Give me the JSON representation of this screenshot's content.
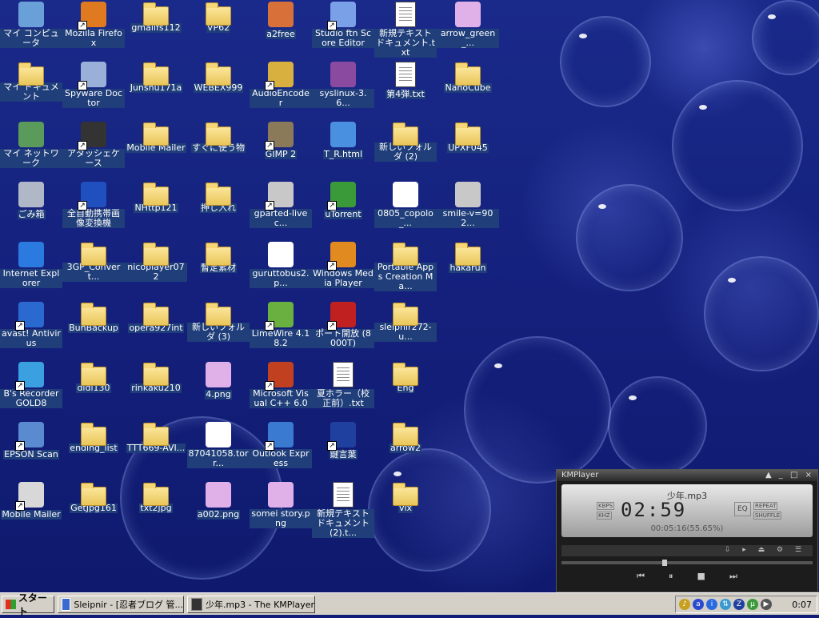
{
  "desktop": {
    "icons": [
      {
        "label": "マイ コンピュータ",
        "kind": "app",
        "icon": "my-computer-icon",
        "color": "#6aa0d8"
      },
      {
        "label": "Mozilla Firefox",
        "kind": "app shortcut",
        "icon": "firefox-icon",
        "color": "#e07a20"
      },
      {
        "label": "gmailfs112",
        "kind": "folder",
        "icon": "folder-icon"
      },
      {
        "label": "VP62",
        "kind": "folder",
        "icon": "folder-icon"
      },
      {
        "label": "a2free",
        "kind": "app",
        "icon": "a2free-icon",
        "color": "#d8703a"
      },
      {
        "label": "Studio ftn Score Editor",
        "kind": "app shortcut",
        "icon": "music-notes-icon",
        "color": "#7aa0e8"
      },
      {
        "label": "新規テキスト ドキュメント.txt",
        "kind": "doc",
        "icon": "text-file-icon"
      },
      {
        "label": "arrow_green_...",
        "kind": "app",
        "icon": "image-file-icon",
        "color": "#e0b0e8"
      },
      {
        "label": "マイ ドキュメント",
        "kind": "folder",
        "icon": "my-documents-icon"
      },
      {
        "label": "Spyware Doctor",
        "kind": "app shortcut",
        "icon": "spyware-doctor-icon",
        "color": "#9ab0d8"
      },
      {
        "label": "Junshu171a",
        "kind": "folder",
        "icon": "folder-icon"
      },
      {
        "label": "WEBEX999",
        "kind": "folder",
        "icon": "folder-icon"
      },
      {
        "label": "AudioEncoder",
        "kind": "app shortcut",
        "icon": "audio-encoder-icon",
        "color": "#d8b040"
      },
      {
        "label": "syslinux-3.6...",
        "kind": "app",
        "icon": "archive-icon",
        "color": "#8a4aa0"
      },
      {
        "label": "第4弾.txt",
        "kind": "doc",
        "icon": "text-file-icon"
      },
      {
        "label": "NanoCube",
        "kind": "folder",
        "icon": "folder-icon"
      },
      {
        "label": "マイ ネットワーク",
        "kind": "app",
        "icon": "my-network-icon",
        "color": "#5a9a5a"
      },
      {
        "label": "アタッシェケース",
        "kind": "app shortcut",
        "icon": "briefcase-icon",
        "color": "#333333"
      },
      {
        "label": "Mobile Mailer",
        "kind": "folder",
        "icon": "folder-icon"
      },
      {
        "label": "すぐに使う物",
        "kind": "folder",
        "icon": "folder-icon"
      },
      {
        "label": "GIMP 2",
        "kind": "app shortcut",
        "icon": "gimp-icon",
        "color": "#8a7a5a"
      },
      {
        "label": "T_R.html",
        "kind": "app",
        "icon": "html-file-icon",
        "color": "#4a90e0"
      },
      {
        "label": "新しいフォルダ (2)",
        "kind": "folder",
        "icon": "folder-icon"
      },
      {
        "label": "UPXF045",
        "kind": "folder",
        "icon": "folder-icon"
      },
      {
        "label": "ごみ箱",
        "kind": "app",
        "icon": "recycle-bin-icon",
        "color": "#b0b8c8"
      },
      {
        "label": "全自動携帯画像変換機",
        "kind": "app shortcut",
        "icon": "phone-converter-icon",
        "color": "#2050c0"
      },
      {
        "label": "NHttp121",
        "kind": "folder",
        "icon": "folder-icon"
      },
      {
        "label": "押し入れ",
        "kind": "folder",
        "icon": "folder-icon"
      },
      {
        "label": "gparted-livec...",
        "kind": "app shortcut",
        "icon": "disc-image-icon",
        "color": "#c8c8c8"
      },
      {
        "label": "uTorrent",
        "kind": "app shortcut",
        "icon": "utorrent-icon",
        "color": "#3a9a3a"
      },
      {
        "label": "0805_copolo_...",
        "kind": "app",
        "icon": "media-file-icon",
        "color": "#ffffff"
      },
      {
        "label": "smile-v=902...",
        "kind": "app",
        "icon": "disc-image-icon",
        "color": "#c8c8c8"
      },
      {
        "label": "Internet Explorer",
        "kind": "app",
        "icon": "internet-explorer-icon",
        "color": "#2a7ae0"
      },
      {
        "label": "3GP_Convert...",
        "kind": "folder",
        "icon": "folder-icon"
      },
      {
        "label": "nicoplayer072",
        "kind": "folder",
        "icon": "folder-icon"
      },
      {
        "label": "暫定素材",
        "kind": "folder",
        "icon": "folder-icon"
      },
      {
        "label": "guruttobus2.p...",
        "kind": "app",
        "icon": "media-file-icon",
        "color": "#ffffff"
      },
      {
        "label": "Windows Media Player",
        "kind": "app shortcut",
        "icon": "windows-media-player-icon",
        "color": "#e08a20"
      },
      {
        "label": "Portable Apps Creation Ma...",
        "kind": "folder",
        "icon": "folder-icon"
      },
      {
        "label": "hakarun",
        "kind": "folder",
        "icon": "folder-icon"
      },
      {
        "label": "avast! Antivirus",
        "kind": "app shortcut",
        "icon": "avast-icon",
        "color": "#2a6ad0"
      },
      {
        "label": "BunBackup",
        "kind": "folder",
        "icon": "folder-icon"
      },
      {
        "label": "opera927int",
        "kind": "folder",
        "icon": "folder-icon"
      },
      {
        "label": "新しいフォルダ (3)",
        "kind": "folder",
        "icon": "folder-icon"
      },
      {
        "label": "LimeWire 4.18.2",
        "kind": "app shortcut",
        "icon": "limewire-icon",
        "color": "#6ab040"
      },
      {
        "label": "ポート開放 (8000T)",
        "kind": "app shortcut",
        "icon": "port-open-icon",
        "color": "#c02020"
      },
      {
        "label": "sleipnir272-u...",
        "kind": "folder",
        "icon": "folder-icon"
      },
      {
        "label": "",
        "kind": "none",
        "icon": ""
      },
      {
        "label": "B's Recorder GOLD8",
        "kind": "app shortcut",
        "icon": "bs-recorder-icon",
        "color": "#3aa0e0"
      },
      {
        "label": "dldl130",
        "kind": "folder",
        "icon": "folder-icon"
      },
      {
        "label": "rinkaku210",
        "kind": "folder",
        "icon": "folder-icon"
      },
      {
        "label": "4.png",
        "kind": "app",
        "icon": "image-file-icon",
        "color": "#e0b0e8"
      },
      {
        "label": "Microsoft Visual C++ 6.0",
        "kind": "app shortcut",
        "icon": "visual-cpp-icon",
        "color": "#c04020"
      },
      {
        "label": "夏ホラー（校正前）.txt",
        "kind": "doc",
        "icon": "text-file-icon"
      },
      {
        "label": "Eng",
        "kind": "folder",
        "icon": "folder-icon"
      },
      {
        "label": "",
        "kind": "none",
        "icon": ""
      },
      {
        "label": "EPSON Scan",
        "kind": "app shortcut",
        "icon": "scanner-icon",
        "color": "#5a8ad0"
      },
      {
        "label": "ending_list",
        "kind": "folder",
        "icon": "folder-icon"
      },
      {
        "label": "TTT669-AVI...",
        "kind": "folder",
        "icon": "folder-icon"
      },
      {
        "label": "87041058.torr...",
        "kind": "app",
        "icon": "torrent-file-icon",
        "color": "#ffffff"
      },
      {
        "label": "Outlook Express",
        "kind": "app shortcut",
        "icon": "outlook-express-icon",
        "color": "#3a7ad0"
      },
      {
        "label": "鍵言葉",
        "kind": "app shortcut",
        "icon": "key-icon",
        "color": "#2040a0"
      },
      {
        "label": "arrow2",
        "kind": "folder",
        "icon": "folder-icon"
      },
      {
        "label": "",
        "kind": "none",
        "icon": ""
      },
      {
        "label": "Mobile Mailer",
        "kind": "app shortcut",
        "icon": "mobile-mailer-icon",
        "color": "#d8d8d8"
      },
      {
        "label": "GetJpg161",
        "kind": "folder",
        "icon": "folder-icon"
      },
      {
        "label": "txt2jpg",
        "kind": "folder",
        "icon": "folder-icon"
      },
      {
        "label": "a002.png",
        "kind": "app",
        "icon": "image-file-icon",
        "color": "#e0b0e8"
      },
      {
        "label": "somei story.png",
        "kind": "app",
        "icon": "image-file-icon",
        "color": "#e0b0e8"
      },
      {
        "label": "新規テキスト ドキュメント (2).t...",
        "kind": "doc",
        "icon": "text-file-icon"
      },
      {
        "label": "vix",
        "kind": "folder",
        "icon": "folder-icon"
      },
      {
        "label": "",
        "kind": "none",
        "icon": ""
      }
    ]
  },
  "taskbar": {
    "start_label": "スタート",
    "tasks": [
      {
        "label": "Sleipnir - [忍者ブログ 管...",
        "icon": "sleipnir-icon"
      },
      {
        "label": "少年.mp3 - The KMPlayer",
        "icon": "kmplayer-icon"
      }
    ],
    "tray_icons": [
      {
        "name": "volume-icon",
        "color": "#c8a020",
        "glyph": "♪"
      },
      {
        "name": "avast-tray-icon",
        "color": "#2a4ad0",
        "glyph": "a"
      },
      {
        "name": "info-tray-icon",
        "color": "#2a6ae0",
        "glyph": "i"
      },
      {
        "name": "network-tray-icon",
        "color": "#3a9ad0",
        "glyph": "⇅"
      },
      {
        "name": "z-tray-icon",
        "color": "#2040a0",
        "glyph": "Z"
      },
      {
        "name": "utorrent-tray-icon",
        "color": "#3a9a3a",
        "glyph": "µ"
      },
      {
        "name": "media-tray-icon",
        "color": "#555555",
        "glyph": "▶"
      }
    ],
    "clock": "0:07"
  },
  "kmplayer": {
    "title": "KMPlayer",
    "file": "少年.mp3",
    "time": "02:59",
    "sub": "00:05:16(55.65%)",
    "labels": {
      "mode1": "KBPS",
      "mode2": "KHZ",
      "eq": "EQ",
      "repeat": "REPEAT",
      "shuffle": "SHUFFLE"
    },
    "seek_percent": 41
  }
}
